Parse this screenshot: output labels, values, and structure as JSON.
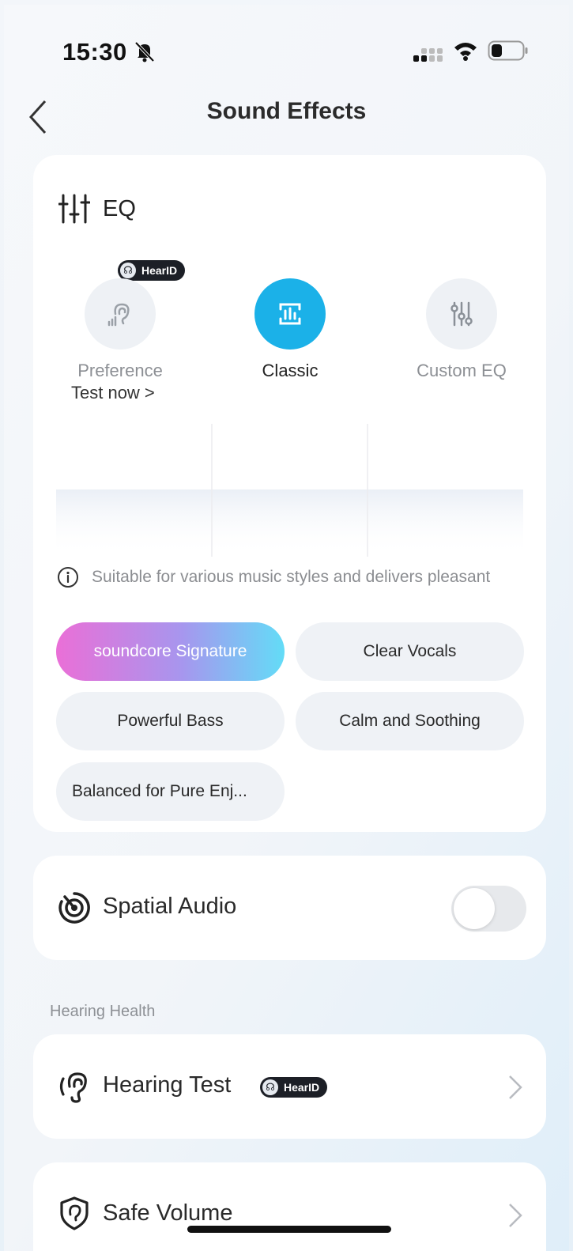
{
  "status_bar": {
    "time": "15:30"
  },
  "header": {
    "title": "Sound Effects"
  },
  "eq": {
    "title": "EQ",
    "modes": [
      {
        "label": "Preference",
        "active": false
      },
      {
        "label": "Classic",
        "active": true
      },
      {
        "label": "Custom EQ",
        "active": false
      }
    ],
    "hearid_badge": "HearID",
    "test_now": "Test now >",
    "info": "Suitable for various music styles and delivers pleasant",
    "presets": [
      {
        "label": "soundcore Signature",
        "active": true
      },
      {
        "label": "Clear Vocals",
        "active": false
      },
      {
        "label": "Powerful Bass",
        "active": false
      },
      {
        "label": "Calm and Soothing",
        "active": false
      },
      {
        "label": "Balanced for Pure Enj...",
        "active": false
      }
    ]
  },
  "spatial_audio": {
    "label": "Spatial Audio",
    "enabled": false
  },
  "hearing_health": {
    "section_label": "Hearing Health",
    "hearing_test": {
      "label": "Hearing Test",
      "badge": "HearID"
    },
    "safe_volume": {
      "label": "Safe Volume"
    }
  },
  "colors": {
    "accent": "#1bb1e8",
    "gradient_start": "#ea6fd7",
    "gradient_end": "#63dcf7"
  }
}
